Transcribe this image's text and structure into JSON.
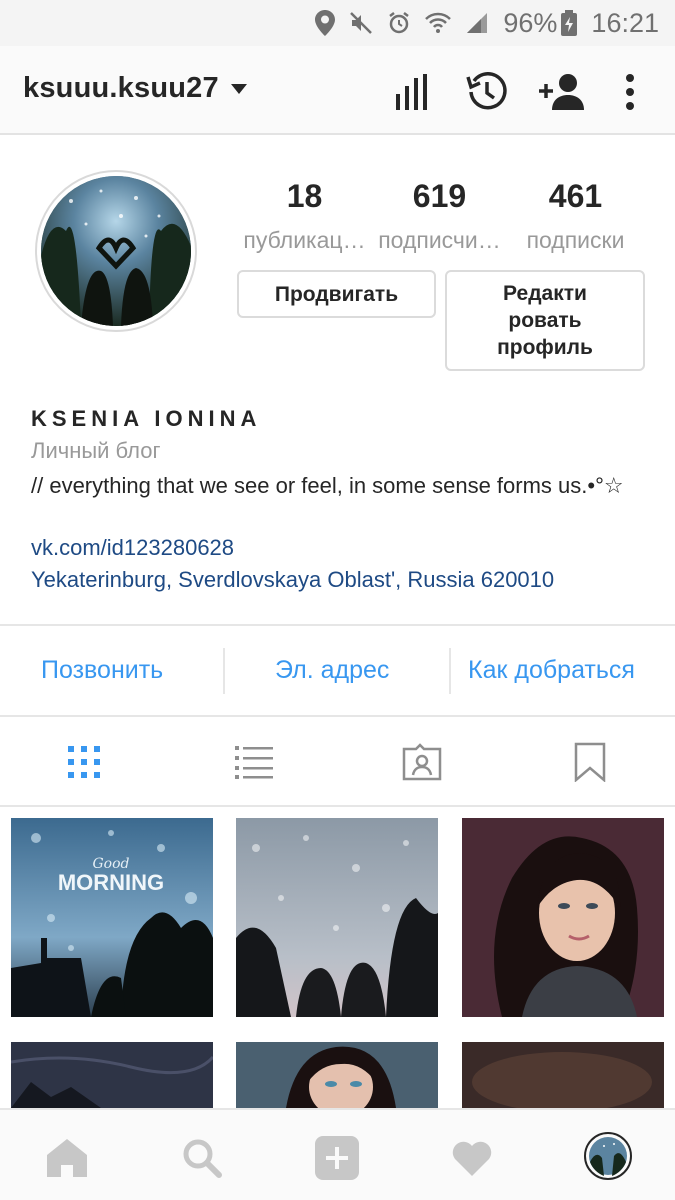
{
  "status_bar": {
    "battery": "96%",
    "time": "16:21",
    "icons": [
      "location-icon",
      "mute-icon",
      "alarm-icon",
      "wifi-icon",
      "signal-icon",
      "battery-charging-icon"
    ]
  },
  "header": {
    "username": "ksuuu.ksuu27",
    "icons": [
      "insights-icon",
      "archive-icon",
      "add-person-icon",
      "more-icon"
    ]
  },
  "profile": {
    "stats": [
      {
        "value": "18",
        "label": "публикац…"
      },
      {
        "value": "619",
        "label": "подписчи…"
      },
      {
        "value": "461",
        "label": "подписки"
      }
    ],
    "promote_button": "Продвигать",
    "edit_button_lines": [
      "Редакти",
      "ровать",
      "профиль"
    ],
    "full_name": "KSENIA IONINA",
    "category": "Личный блог",
    "bio": "// everything that we see or feel, in some sense forms us.•°☆",
    "link": "vk.com/id123280628",
    "address": "Yekaterinburg, Sverdlovskaya Oblast', Russia 620010"
  },
  "contact_bar": {
    "call": "Позвонить",
    "email": "Эл. адрес",
    "directions": "Как добраться"
  },
  "tabs": [
    "grid-icon",
    "list-icon",
    "tagged-icon",
    "saved-icon"
  ],
  "grid": {
    "post1_overlay_small": "Good",
    "post1_overlay_big": "MORNING"
  },
  "bottom_nav": [
    "home-icon",
    "search-icon",
    "add-icon",
    "heart-icon",
    "profile-avatar"
  ],
  "colors": {
    "accent": "#3897f0",
    "link": "#1e4a84",
    "text": "#262626",
    "muted": "#999999"
  }
}
